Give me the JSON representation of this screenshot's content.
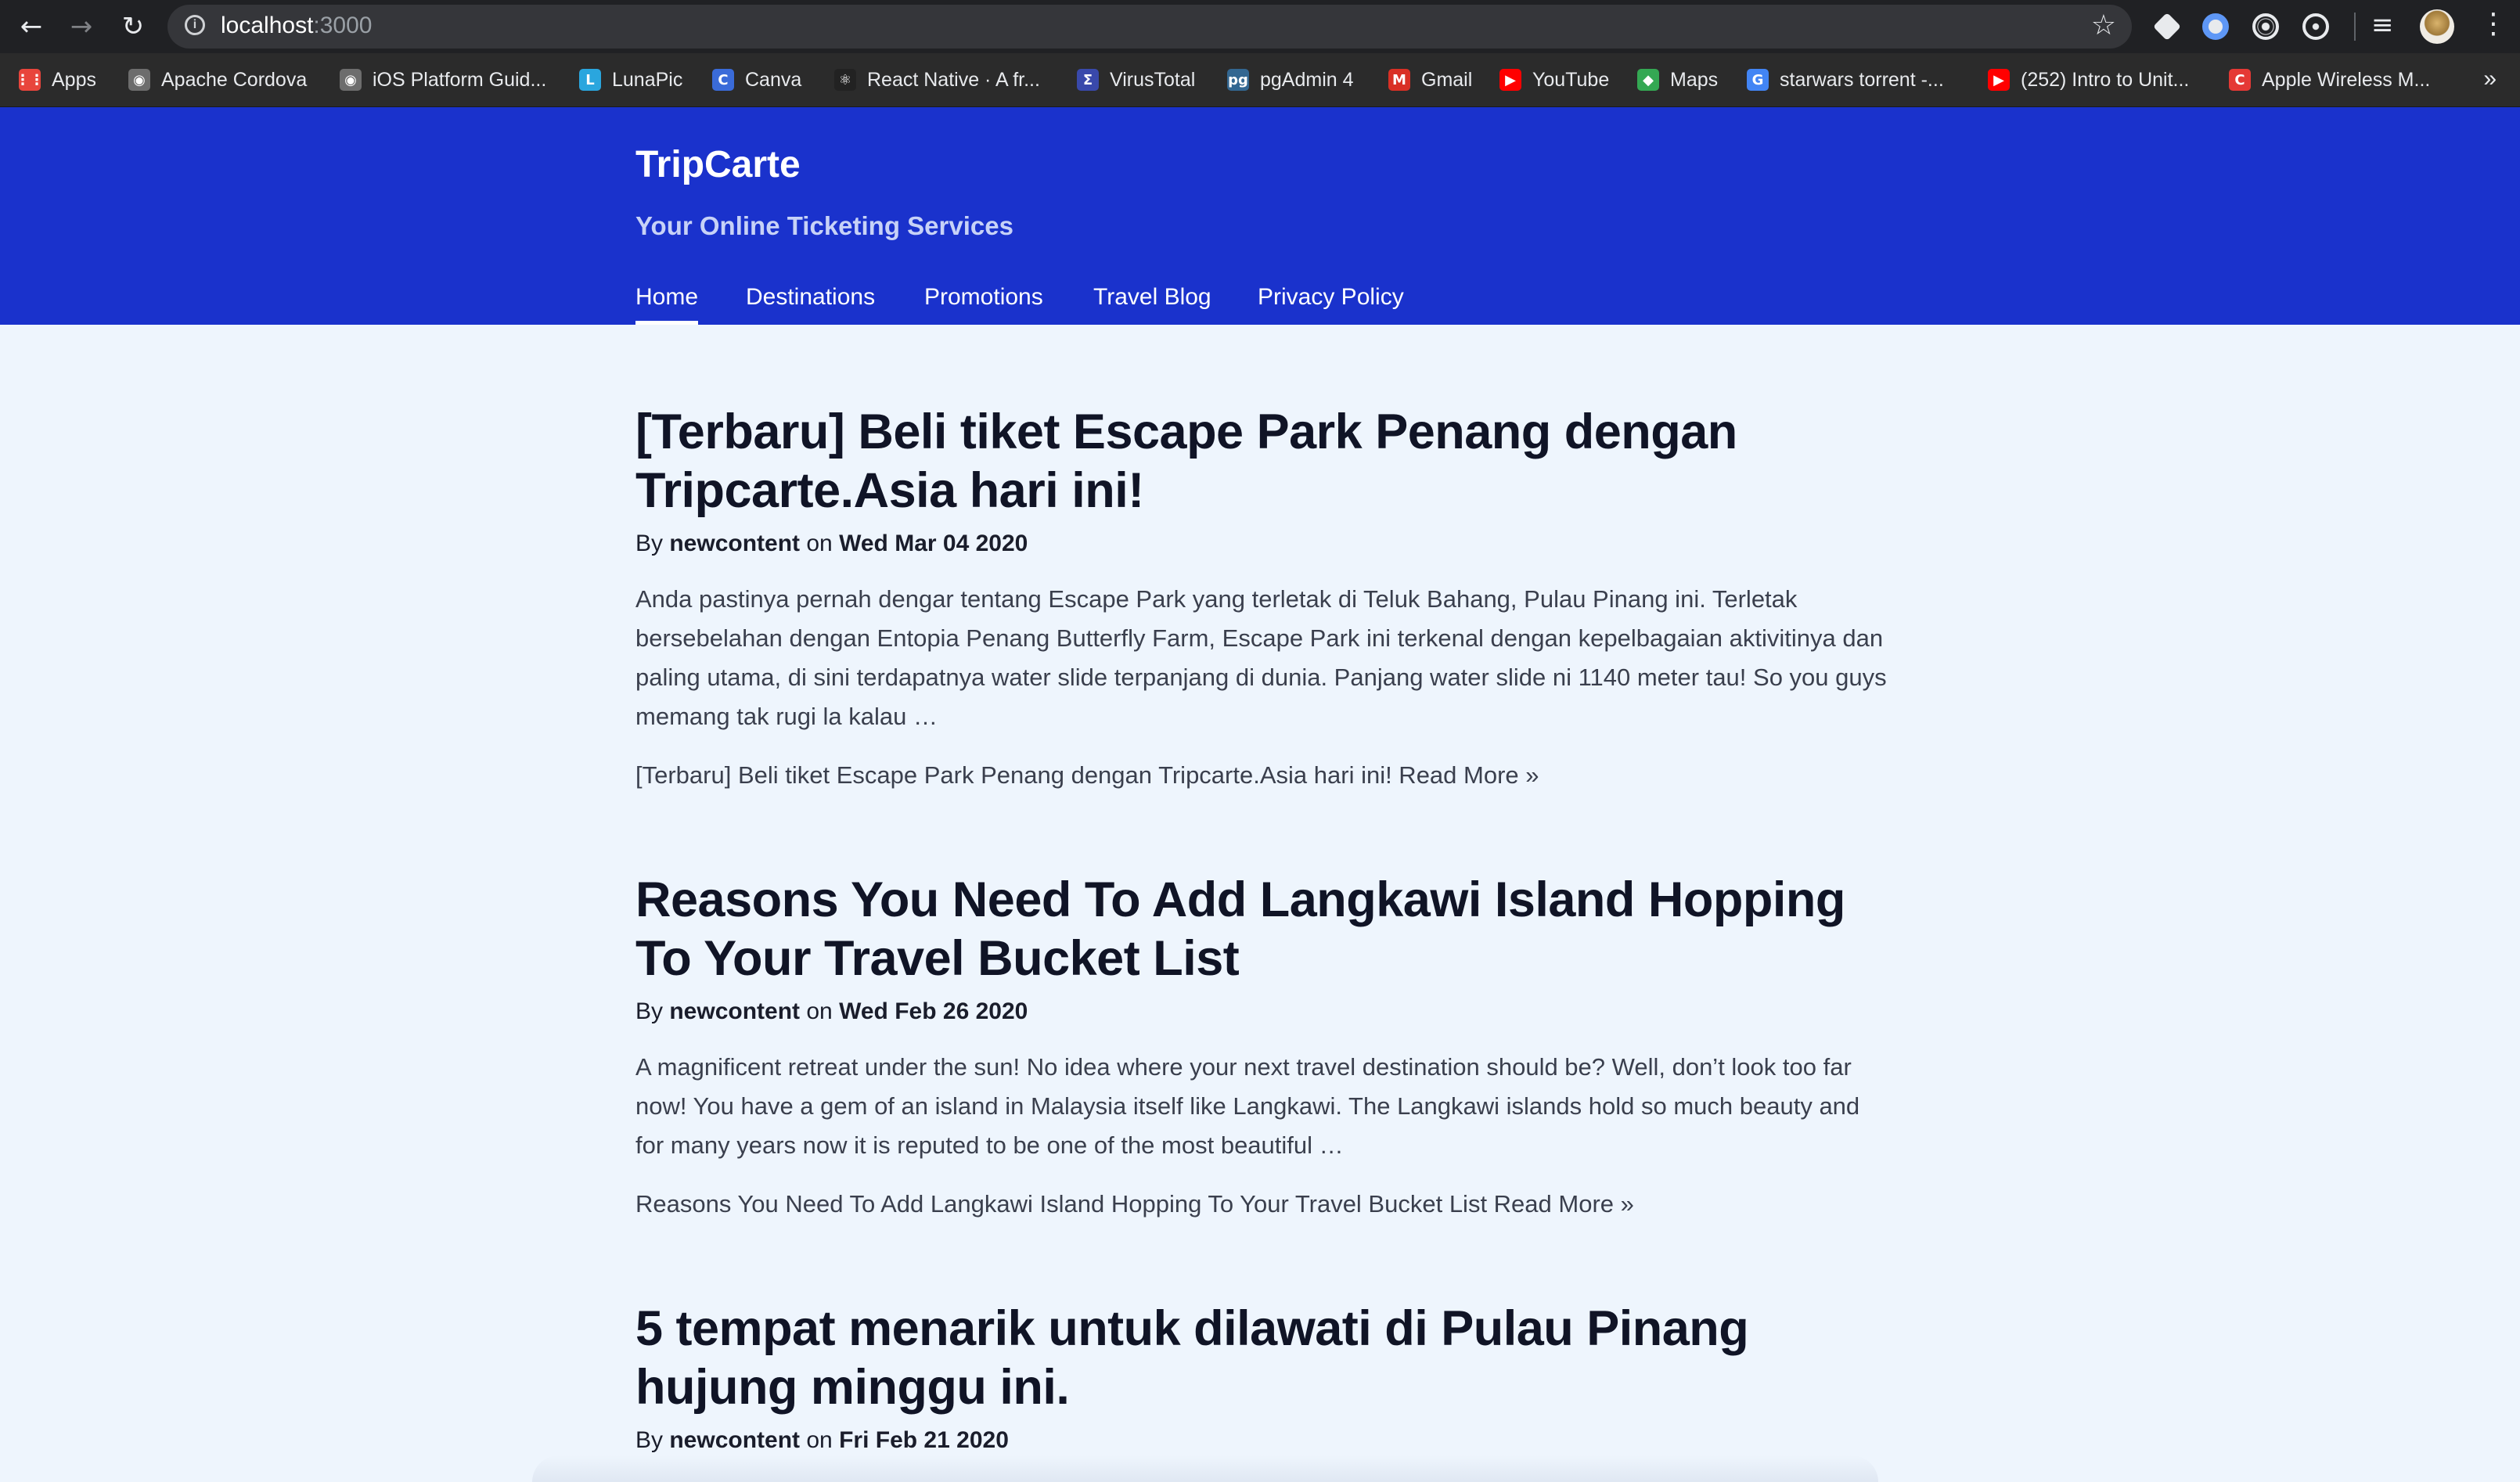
{
  "browser": {
    "url_host": "localhost",
    "url_port": ":3000",
    "back_icon": "←",
    "forward_icon": "→",
    "reload_icon": "↻",
    "star_icon": "☆",
    "menu_icon": "⋮",
    "playlist_icon": "≡",
    "bookmarks": [
      {
        "label": "Apps",
        "icon": "apps-grid-icon",
        "color": "#e8453c",
        "glyph": "⋮⋮"
      },
      {
        "label": "Apache Cordova",
        "icon": "cordova-icon",
        "color": "#6d6d6d",
        "glyph": "◉"
      },
      {
        "label": "iOS Platform Guid...",
        "icon": "cordova-icon",
        "color": "#6d6d6d",
        "glyph": "◉"
      },
      {
        "label": "LunaPic",
        "icon": "lunapic-icon",
        "color": "#2aa6de",
        "glyph": "L"
      },
      {
        "label": "Canva",
        "icon": "canva-icon",
        "color": "#3a6bd9",
        "glyph": "C"
      },
      {
        "label": "React Native · A fr...",
        "icon": "react-icon",
        "color": "#222222",
        "glyph": "⚛"
      },
      {
        "label": "VirusTotal",
        "icon": "virustotal-icon",
        "color": "#3949ab",
        "glyph": "Σ"
      },
      {
        "label": "pgAdmin 4",
        "icon": "pgadmin-icon",
        "color": "#336791",
        "glyph": "pg"
      },
      {
        "label": "Gmail",
        "icon": "gmail-icon",
        "color": "#d93025",
        "glyph": "M"
      },
      {
        "label": "YouTube",
        "icon": "youtube-icon",
        "color": "#ff0000",
        "glyph": "▶"
      },
      {
        "label": "Maps",
        "icon": "maps-icon",
        "color": "#34a853",
        "glyph": "◆"
      },
      {
        "label": "starwars torrent -...",
        "icon": "google-icon",
        "color": "#4285f4",
        "glyph": "G"
      },
      {
        "label": "(252) Intro to Unit...",
        "icon": "youtube-icon",
        "color": "#ff0000",
        "glyph": "▶"
      },
      {
        "label": "Apple Wireless M...",
        "icon": "bookmark-c-icon",
        "color": "#e53935",
        "glyph": "C"
      }
    ],
    "more_bookmarks": "»"
  },
  "site": {
    "title": "TripCarte",
    "tagline": "Your Online Ticketing Services",
    "nav": [
      {
        "label": "Home",
        "active": true
      },
      {
        "label": "Destinations",
        "active": false
      },
      {
        "label": "Promotions",
        "active": false
      },
      {
        "label": "Travel Blog",
        "active": false
      },
      {
        "label": "Privacy Policy",
        "active": false
      }
    ]
  },
  "posts": [
    {
      "title": "[Terbaru] Beli tiket Escape Park Penang dengan Tripcarte.Asia hari ini!",
      "by": "By",
      "author": "newcontent",
      "on": "on",
      "date": "Wed Mar 04 2020",
      "excerpt": "Anda pastinya pernah dengar tentang Escape Park yang terletak di Teluk Bahang, Pulau Pinang ini. Terletak bersebelahan dengan Entopia Penang Butterfly Farm, Escape Park ini terkenal dengan kepelbagaian aktivitinya dan paling utama, di sini terdapatnya water slide terpanjang di dunia. Panjang water slide ni 1140 meter tau! So you guys memang tak rugi la kalau …",
      "read_more": "[Terbaru] Beli tiket Escape Park Penang dengan Tripcarte.Asia hari ini! Read More »"
    },
    {
      "title": "Reasons You Need To Add Langkawi Island Hopping To Your Travel Bucket List",
      "by": "By",
      "author": "newcontent",
      "on": "on",
      "date": "Wed Feb 26 2020",
      "excerpt": "A magnificent retreat under the sun! No idea where your next travel destination should be? Well, don’t look too far now! You have a gem of an island in Malaysia itself like Langkawi. The Langkawi islands hold so much beauty and for many years now it is reputed to be one of the most beautiful …",
      "read_more": "Reasons You Need To Add Langkawi Island Hopping To Your Travel Bucket List Read More »"
    },
    {
      "title": "5 tempat menarik untuk dilawati di Pulau Pinang hujung minggu ini.",
      "by": "By",
      "author": "newcontent",
      "on": "on",
      "date": "Fri Feb 21 2020"
    }
  ]
}
